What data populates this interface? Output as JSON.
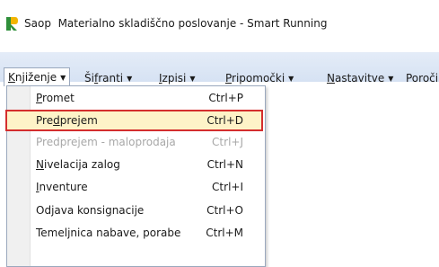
{
  "window": {
    "title_app": "Saop",
    "title_rest": "Materialno skladiščno poslovanje - Smart Running",
    "icon": "app-logo-icon"
  },
  "menubar": {
    "items": [
      {
        "pre": "",
        "mn": "K",
        "post": "njiženje",
        "icon": "chevron-down-icon"
      },
      {
        "pre": "Ši",
        "mn": "f",
        "post": "ranti",
        "icon": "chevron-down-icon"
      },
      {
        "pre": "",
        "mn": "I",
        "post": "zpisi",
        "icon": "chevron-down-icon"
      },
      {
        "pre": "",
        "mn": "P",
        "post": "ripomočki",
        "icon": "chevron-down-icon"
      },
      {
        "pre": "",
        "mn": "N",
        "post": "astavitve",
        "icon": "chevron-down-icon"
      },
      {
        "pre": "",
        "mn": "",
        "post": "Poroči",
        "icon": ""
      }
    ]
  },
  "dropdown": {
    "items": [
      {
        "pre": "",
        "mn": "P",
        "post": "romet",
        "shortcut": "Ctrl+P",
        "state": "normal"
      },
      {
        "pre": "Pre",
        "mn": "d",
        "post": "prejem",
        "shortcut": "Ctrl+D",
        "state": "highlighted"
      },
      {
        "pre": "",
        "mn": "",
        "post": "Predprejem - maloprodaja",
        "shortcut": "Ctrl+J",
        "state": "disabled"
      },
      {
        "pre": "",
        "mn": "N",
        "post": "ivelacija zalog",
        "shortcut": "Ctrl+N",
        "state": "normal"
      },
      {
        "pre": "",
        "mn": "I",
        "post": "nventure",
        "shortcut": "Ctrl+I",
        "state": "normal"
      },
      {
        "pre": "",
        "mn": "",
        "post": "Odjava konsignacije",
        "shortcut": "Ctrl+O",
        "state": "normal"
      },
      {
        "pre": "",
        "mn": "",
        "post": "Temeljnica nabave, porabe",
        "shortcut": "Ctrl+M",
        "state": "normal"
      }
    ]
  },
  "colors": {
    "highlight_border": "#d42e2e",
    "highlight_fill": "#fef3c8",
    "menubar_bg": "#dce6f4",
    "disabled_text": "#a8a8a8"
  }
}
